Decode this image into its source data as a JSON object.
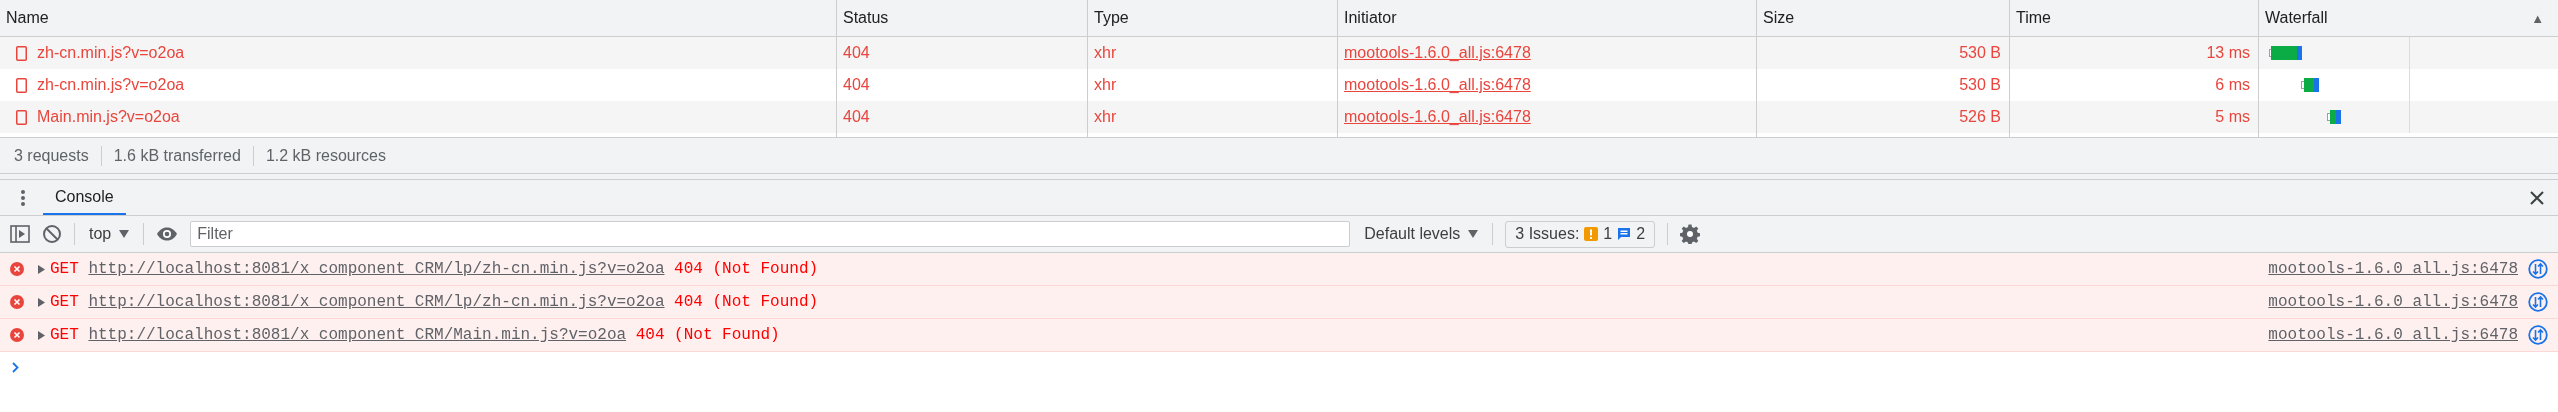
{
  "network": {
    "columns": [
      "Name",
      "Status",
      "Type",
      "Initiator",
      "Size",
      "Time",
      "Waterfall"
    ],
    "sort_indicator": "▲",
    "requests": [
      {
        "name": "zh-cn.min.js?v=o2oa",
        "status": "404",
        "type": "xhr",
        "initiator": "mootools-1.6.0_all.js:6478",
        "size": "530 B",
        "time": "13 ms",
        "failed": true
      },
      {
        "name": "zh-cn.min.js?v=o2oa",
        "status": "404",
        "type": "xhr",
        "initiator": "mootools-1.6.0_all.js:6478",
        "size": "530 B",
        "time": "6 ms",
        "failed": true
      },
      {
        "name": "Main.min.js?v=o2oa",
        "status": "404",
        "type": "xhr",
        "initiator": "mootools-1.6.0_all.js:6478",
        "size": "526 B",
        "time": "5 ms",
        "failed": true
      }
    ],
    "summary": [
      "3 requests",
      "1.6 kB transferred",
      "1.2 kB resources"
    ]
  },
  "drawer": {
    "tabs": [
      {
        "label": "Console",
        "selected": true
      }
    ]
  },
  "toolbar": {
    "context": "top",
    "filter": {
      "placeholder": "Filter"
    },
    "levels": "Default levels",
    "issues": {
      "label": "3 Issues:",
      "warnings": "1",
      "infos": "2"
    }
  },
  "console": {
    "messages": [
      {
        "kind": "error",
        "method": "GET",
        "url": "http://localhost:8081/x_component_CRM/lp/zh-cn.min.js?v=o2oa",
        "result": "404 (Not Found)",
        "source": "mootools-1.6.0_all.js:6478"
      },
      {
        "kind": "error",
        "method": "GET",
        "url": "http://localhost:8081/x_component_CRM/lp/zh-cn.min.js?v=o2oa",
        "result": "404 (Not Found)",
        "source": "mootools-1.6.0_all.js:6478"
      },
      {
        "kind": "error",
        "method": "GET",
        "url": "http://localhost:8081/x_component_CRM/Main.min.js?v=o2oa",
        "result": "404 (Not Found)",
        "source": "mootools-1.6.0_all.js:6478"
      }
    ]
  }
}
